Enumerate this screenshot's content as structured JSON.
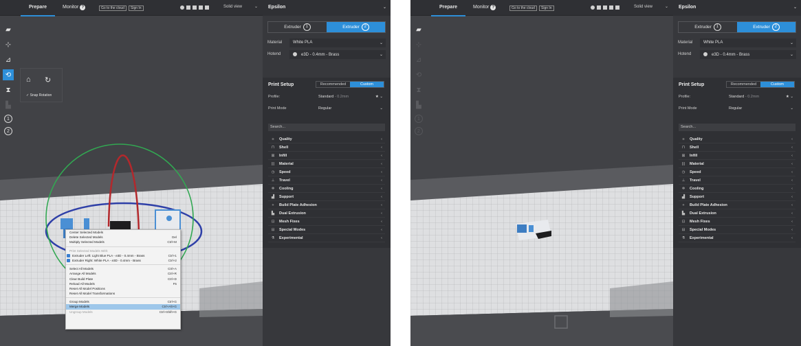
{
  "colors": {
    "accent": "#2d8fd9",
    "background": "#343539",
    "sidebar": "#37383c",
    "menu_highlight": "#9ec7ea"
  },
  "icons": [
    "open-file-icon",
    "move-icon",
    "scale-icon",
    "rotate-icon",
    "mirror-icon",
    "per-model-settings-icon",
    "support-blocker-icon",
    "help-icon",
    "help-filled-icon",
    "info-icon",
    "chevron-down-icon",
    "star-icon",
    "quality-icon",
    "shell-icon",
    "infill-icon",
    "material-icon",
    "speed-icon",
    "travel-icon",
    "cooling-icon",
    "support-icon",
    "adhesion-icon",
    "dual-extrusion-icon",
    "mesh-fixes-icon",
    "special-modes-icon",
    "experimental-icon",
    "lay-flat-icon",
    "select-face-icon",
    "checkmark-icon",
    "camera-reset-icon"
  ],
  "left": {
    "topbar": {
      "prepare": "Prepare",
      "monitor": "Monitor",
      "cloud": "Go to the cloud",
      "signin": "Sign In",
      "view": "Solid view"
    },
    "snap_rotation": "Snap Rotation",
    "tool_numbers": [
      "1",
      "2"
    ],
    "sidebar": {
      "printer": "Epsilon",
      "extruder_label": "Extruder",
      "extruder_nums": [
        "1",
        "2"
      ],
      "material_key": "Material",
      "material_val": "White PLA",
      "hotend_key": "Hotend",
      "hotend_val": "e3D - 0.4mm - Brass",
      "setup_title": "Print Setup",
      "recommended": "Recommended",
      "custom": "Custom",
      "profile_key": "Profile:",
      "profile_val": "Standard",
      "profile_dim": " - 0.2mm",
      "mode_key": "Print Mode",
      "mode_val": "Regular",
      "search": "Search...",
      "categories": [
        "Quality",
        "Shell",
        "Infill",
        "Material",
        "Speed",
        "Travel",
        "Cooling",
        "Support",
        "Build Plate Adhesion",
        "Dual Extrusion",
        "Mesh Fixes",
        "Special Modes",
        "Experimental"
      ]
    },
    "menu": [
      {
        "label": "Center Selected Models",
        "sc": ""
      },
      {
        "label": "Delete Selected Models",
        "sc": "Del"
      },
      {
        "label": "Multiply Selected Models",
        "sc": "Ctrl+M"
      },
      {
        "label": "",
        "sc": ""
      },
      {
        "label": "Print Selected Models With:",
        "sc": ""
      },
      {
        "label": "Extruder Left: Light Blue PLA - e3D - 0.4mm - Brass",
        "sc": "Ctrl+1"
      },
      {
        "label": "Extruder Right: White PLA - e3D - 0.4mm - Brass",
        "sc": "Ctrl+2"
      },
      {
        "label": "",
        "sc": ""
      },
      {
        "label": "Select All Models",
        "sc": "Ctrl+A"
      },
      {
        "label": "Arrange All Models",
        "sc": "Ctrl+R"
      },
      {
        "label": "Clear Build Plate",
        "sc": "Ctrl+D"
      },
      {
        "label": "Reload All Models",
        "sc": "F5"
      },
      {
        "label": "Reset All Model Positions",
        "sc": ""
      },
      {
        "label": "Reset All Model Transformations",
        "sc": ""
      },
      {
        "label": "",
        "sc": ""
      },
      {
        "label": "Group Models",
        "sc": "Ctrl+G"
      },
      {
        "label": "Merge Models",
        "sc": "Ctrl+Alt+G"
      },
      {
        "label": "Ungroup Models",
        "sc": "Ctrl+Shift+G"
      }
    ]
  },
  "right": {
    "topbar": {
      "prepare": "Prepare",
      "monitor": "Monitor",
      "cloud": "Go to the cloud",
      "signin": "Sign In",
      "view": "Solid view"
    },
    "tool_numbers": [
      "1",
      "2"
    ],
    "sidebar": {
      "printer": "Epsilon",
      "extruder_label": "Extruder",
      "extruder_nums": [
        "1",
        "2"
      ],
      "material_key": "Material",
      "material_val": "White PLA",
      "hotend_key": "Hotend",
      "hotend_val": "e3D - 0.4mm - Brass",
      "setup_title": "Print Setup",
      "recommended": "Recommended",
      "custom": "Custom",
      "profile_key": "Profile:",
      "profile_val": "Standard",
      "profile_dim": " - 0.2mm",
      "mode_key": "Print Mode",
      "mode_val": "Regular",
      "search": "Search...",
      "categories": [
        "Quality",
        "Shell",
        "Infill",
        "Material",
        "Speed",
        "Travel",
        "Cooling",
        "Support",
        "Build Plate Adhesion",
        "Dual Extrusion",
        "Mesh Fixes",
        "Special Modes",
        "Experimental"
      ]
    }
  }
}
